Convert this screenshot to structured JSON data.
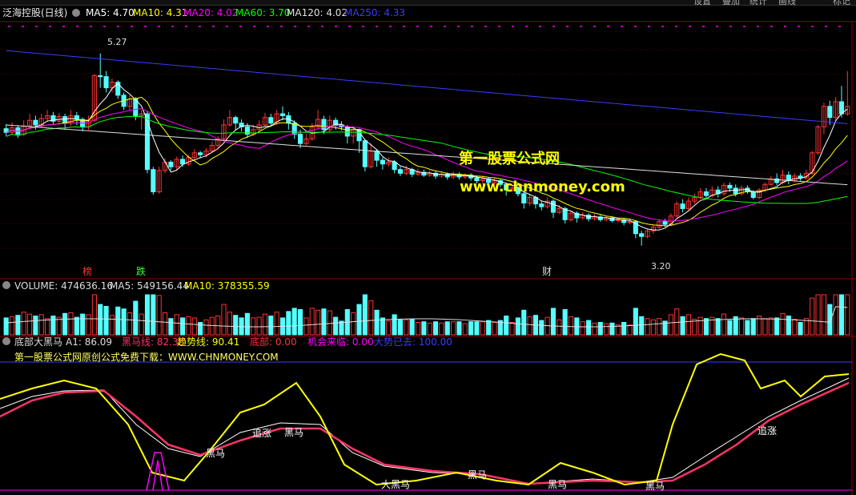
{
  "main_header": {
    "stock": "泛海控股(日线)",
    "items": [
      {
        "label": "MA5: 4.70",
        "color": "#ffffff"
      },
      {
        "label": "MA10: 4.31",
        "color": "#ffff00"
      },
      {
        "label": "MA20: 4.02",
        "color": "#ff00ff"
      },
      {
        "label": "MA60: 3.70",
        "color": "#00ff00"
      },
      {
        "label": "MA120: 4.02",
        "color": "#e0e0e0"
      },
      {
        "label": "MA250: 4.33",
        "color": "#3b3bff"
      }
    ]
  },
  "top_buttons": [
    "设置",
    "叠加",
    "统计",
    "画线",
    "标记"
  ],
  "annotations": {
    "high": "5.27",
    "low": "3.20"
  },
  "markers": [
    {
      "text": "榜",
      "color": "#ff3333"
    },
    {
      "text": "跌",
      "color": "#33ff33"
    },
    {
      "text": "财",
      "color": "#dddddd"
    }
  ],
  "watermark": {
    "line1": "第一股票公式网",
    "line2": "www.chnmoney.com"
  },
  "volume_header": {
    "items": [
      {
        "label": "VOLUME: 474636.16",
        "color": "#dddddd"
      },
      {
        "label": "MA5: 549156.44",
        "color": "#dddddd"
      },
      {
        "label": "MA10: 378355.59",
        "color": "#ffff00"
      }
    ]
  },
  "indicator_header": {
    "items": [
      {
        "label": "底部大黑马",
        "color": "#dddddd"
      },
      {
        "label": "A1: 86.09",
        "color": "#dddddd"
      },
      {
        "label": "黑马线: 82.38",
        "color": "#ff3366"
      },
      {
        "label": "趋势线: 90.41",
        "color": "#ffff00"
      },
      {
        "label": "底部: 0.00",
        "color": "#ff3333"
      },
      {
        "label": "机会来临: 0.00",
        "color": "#ff00ff"
      },
      {
        "label": "大势已去: 100.00",
        "color": "#3b3bff"
      }
    ],
    "subtitle": "第一股票公式网原创公式免费下载：WWW.CHNMONEY.COM"
  },
  "indicator_labels": [
    "黑马",
    "追涨",
    "黑马",
    "黑马",
    "大黑马",
    "黑马",
    "黑马",
    "追涨"
  ],
  "chart_data": {
    "type": "candlestick",
    "price_range": [
      3.0,
      5.5
    ],
    "candles": [
      [
        4.46,
        4.42,
        4.51,
        4.38
      ],
      [
        4.42,
        4.47,
        4.53,
        4.39
      ],
      [
        4.47,
        4.4,
        4.5,
        4.36
      ],
      [
        4.4,
        4.49,
        4.55,
        4.38
      ],
      [
        4.49,
        4.55,
        4.62,
        4.45
      ],
      [
        4.55,
        4.5,
        4.6,
        4.45
      ],
      [
        4.5,
        4.57,
        4.62,
        4.47
      ],
      [
        4.57,
        4.6,
        4.66,
        4.53
      ],
      [
        4.6,
        4.54,
        4.64,
        4.5
      ],
      [
        4.54,
        4.59,
        4.63,
        4.5
      ],
      [
        4.59,
        4.52,
        4.62,
        4.45
      ],
      [
        4.52,
        4.6,
        4.66,
        4.49
      ],
      [
        4.6,
        4.56,
        4.64,
        4.5
      ],
      [
        4.56,
        4.48,
        4.58,
        4.43
      ],
      [
        4.48,
        4.55,
        4.6,
        4.45
      ],
      [
        4.55,
        5.03,
        5.05,
        4.53
      ],
      [
        5.03,
        5.02,
        5.27,
        4.9
      ],
      [
        5.02,
        4.9,
        5.08,
        4.85
      ],
      [
        4.9,
        4.96,
        5.0,
        4.85
      ],
      [
        4.96,
        4.82,
        4.98,
        4.78
      ],
      [
        4.82,
        4.7,
        4.85,
        4.66
      ],
      [
        4.7,
        4.78,
        4.82,
        4.65
      ],
      [
        4.78,
        4.6,
        4.8,
        4.55
      ],
      [
        4.6,
        4.62,
        4.66,
        4.45
      ],
      [
        4.62,
        4.02,
        4.65,
        3.98
      ],
      [
        4.02,
        3.78,
        4.05,
        3.75
      ],
      [
        3.78,
        4.01,
        4.05,
        3.76
      ],
      [
        4.01,
        4.1,
        4.14,
        3.98
      ],
      [
        4.1,
        4.05,
        4.12,
        4.01
      ],
      [
        4.05,
        4.13,
        4.16,
        4.02
      ],
      [
        4.13,
        4.08,
        4.17,
        4.05
      ],
      [
        4.08,
        4.15,
        4.18,
        4.06
      ],
      [
        4.15,
        4.2,
        4.24,
        4.12
      ],
      [
        4.2,
        4.18,
        4.22,
        4.14
      ],
      [
        4.18,
        4.22,
        4.25,
        4.15
      ],
      [
        4.22,
        4.28,
        4.32,
        4.2
      ],
      [
        4.28,
        4.35,
        4.38,
        4.25
      ],
      [
        4.35,
        4.5,
        4.56,
        4.33
      ],
      [
        4.5,
        4.58,
        4.66,
        4.48
      ],
      [
        4.58,
        4.52,
        4.6,
        4.45
      ],
      [
        4.52,
        4.48,
        4.56,
        4.43
      ],
      [
        4.48,
        4.4,
        4.52,
        4.36
      ],
      [
        4.4,
        4.45,
        4.5,
        4.38
      ],
      [
        4.45,
        4.5,
        4.55,
        4.42
      ],
      [
        4.5,
        4.58,
        4.63,
        4.48
      ],
      [
        4.58,
        4.52,
        4.62,
        4.48
      ],
      [
        4.52,
        4.62,
        4.66,
        4.5
      ],
      [
        4.62,
        4.6,
        4.7,
        4.55
      ],
      [
        4.6,
        4.52,
        4.64,
        4.45
      ],
      [
        4.52,
        4.4,
        4.55,
        4.35
      ],
      [
        4.4,
        4.3,
        4.45,
        4.25
      ],
      [
        4.3,
        4.35,
        4.4,
        4.28
      ],
      [
        4.35,
        4.48,
        4.52,
        4.33
      ],
      [
        4.48,
        4.56,
        4.66,
        4.45
      ],
      [
        4.56,
        4.45,
        4.6,
        4.4
      ],
      [
        4.45,
        4.55,
        4.6,
        4.42
      ],
      [
        4.55,
        4.5,
        4.58,
        4.45
      ],
      [
        4.5,
        4.48,
        4.54,
        4.44
      ],
      [
        4.48,
        4.38,
        4.5,
        4.3
      ],
      [
        4.38,
        4.45,
        4.48,
        4.3
      ],
      [
        4.45,
        4.33,
        4.46,
        4.2
      ],
      [
        4.33,
        4.05,
        4.35,
        4.0
      ],
      [
        4.05,
        4.22,
        4.3,
        4.03
      ],
      [
        4.22,
        4.12,
        4.24,
        4.05
      ],
      [
        4.12,
        4.08,
        4.15,
        4.02
      ],
      [
        4.08,
        4.1,
        4.15,
        4.05
      ],
      [
        4.1,
        4.02,
        4.12,
        3.98
      ],
      [
        4.02,
        3.98,
        4.05,
        3.95
      ],
      [
        3.98,
        4.02,
        4.06,
        3.96
      ],
      [
        4.02,
        3.97,
        4.04,
        3.94
      ],
      [
        3.97,
        3.99,
        4.03,
        3.95
      ],
      [
        3.99,
        3.96,
        4.02,
        3.94
      ],
      [
        3.96,
        3.98,
        4.01,
        3.94
      ],
      [
        3.98,
        3.95,
        4.0,
        3.92
      ],
      [
        3.95,
        3.97,
        4.0,
        3.93
      ],
      [
        3.97,
        3.94,
        3.99,
        3.91
      ],
      [
        3.94,
        3.97,
        4.0,
        3.92
      ],
      [
        3.97,
        3.94,
        3.99,
        3.91
      ],
      [
        3.94,
        3.96,
        3.98,
        3.92
      ],
      [
        3.96,
        3.93,
        3.98,
        3.9
      ],
      [
        3.93,
        3.9,
        3.95,
        3.87
      ],
      [
        3.9,
        3.92,
        3.95,
        3.86
      ],
      [
        3.92,
        3.88,
        3.94,
        3.85
      ],
      [
        3.88,
        3.9,
        3.93,
        3.85
      ],
      [
        3.9,
        3.86,
        3.92,
        3.83
      ],
      [
        3.86,
        3.8,
        3.88,
        3.74
      ],
      [
        3.8,
        3.82,
        3.86,
        3.78
      ],
      [
        3.82,
        3.76,
        3.84,
        3.73
      ],
      [
        3.76,
        3.66,
        3.79,
        3.6
      ],
      [
        3.66,
        3.72,
        3.76,
        3.63
      ],
      [
        3.72,
        3.65,
        3.74,
        3.6
      ],
      [
        3.65,
        3.62,
        3.68,
        3.58
      ],
      [
        3.62,
        3.68,
        3.72,
        3.6
      ],
      [
        3.68,
        3.56,
        3.7,
        3.5
      ],
      [
        3.56,
        3.6,
        3.64,
        3.54
      ],
      [
        3.6,
        3.48,
        3.62,
        3.44
      ],
      [
        3.48,
        3.55,
        3.58,
        3.46
      ],
      [
        3.55,
        3.5,
        3.57,
        3.45
      ],
      [
        3.5,
        3.53,
        3.56,
        3.48
      ],
      [
        3.53,
        3.49,
        3.55,
        3.46
      ],
      [
        3.49,
        3.51,
        3.54,
        3.47
      ],
      [
        3.51,
        3.48,
        3.53,
        3.46
      ],
      [
        3.48,
        3.5,
        3.52,
        3.46
      ],
      [
        3.5,
        3.47,
        3.51,
        3.45
      ],
      [
        3.47,
        3.48,
        3.5,
        3.45
      ],
      [
        3.48,
        3.45,
        3.49,
        3.42
      ],
      [
        3.45,
        3.46,
        3.48,
        3.43
      ],
      [
        3.46,
        3.33,
        3.47,
        3.28
      ],
      [
        3.33,
        3.3,
        3.36,
        3.2
      ],
      [
        3.3,
        3.36,
        3.38,
        3.28
      ],
      [
        3.36,
        3.4,
        3.43,
        3.33
      ],
      [
        3.4,
        3.46,
        3.48,
        3.38
      ],
      [
        3.46,
        3.43,
        3.49,
        3.4
      ],
      [
        3.43,
        3.52,
        3.55,
        3.42
      ],
      [
        3.52,
        3.65,
        3.68,
        3.5
      ],
      [
        3.65,
        3.6,
        3.7,
        3.56
      ],
      [
        3.6,
        3.68,
        3.72,
        3.58
      ],
      [
        3.68,
        3.72,
        3.76,
        3.65
      ],
      [
        3.72,
        3.78,
        3.82,
        3.7
      ],
      [
        3.78,
        3.74,
        3.82,
        3.7
      ],
      [
        3.74,
        3.8,
        3.84,
        3.72
      ],
      [
        3.8,
        3.76,
        3.84,
        3.72
      ],
      [
        3.76,
        3.85,
        3.88,
        3.74
      ],
      [
        3.85,
        3.82,
        3.88,
        3.78
      ],
      [
        3.82,
        3.76,
        3.86,
        3.73
      ],
      [
        3.76,
        3.82,
        3.85,
        3.74
      ],
      [
        3.82,
        3.78,
        3.85,
        3.76
      ],
      [
        3.78,
        3.72,
        3.8,
        3.7
      ],
      [
        3.72,
        3.8,
        3.82,
        3.7
      ],
      [
        3.8,
        3.86,
        3.88,
        3.78
      ],
      [
        3.86,
        3.92,
        3.95,
        3.84
      ],
      [
        3.92,
        3.88,
        3.98,
        3.85
      ],
      [
        3.88,
        3.96,
        4.02,
        3.86
      ],
      [
        3.96,
        3.9,
        4.0,
        3.86
      ],
      [
        3.9,
        3.95,
        3.98,
        3.88
      ],
      [
        3.95,
        3.93,
        3.98,
        3.9
      ],
      [
        3.93,
        3.98,
        4.02,
        3.91
      ],
      [
        3.98,
        4.2,
        4.22,
        3.96
      ],
      [
        4.2,
        4.48,
        4.5,
        4.18
      ],
      [
        4.48,
        4.7,
        4.74,
        4.4
      ],
      [
        4.7,
        4.58,
        4.76,
        4.5
      ],
      [
        4.58,
        4.75,
        4.8,
        4.55
      ],
      [
        4.75,
        4.62,
        4.92,
        4.58
      ],
      [
        4.62,
        4.7,
        5.08,
        4.6
      ]
    ],
    "volume_range": [
      0,
      1000000
    ]
  }
}
